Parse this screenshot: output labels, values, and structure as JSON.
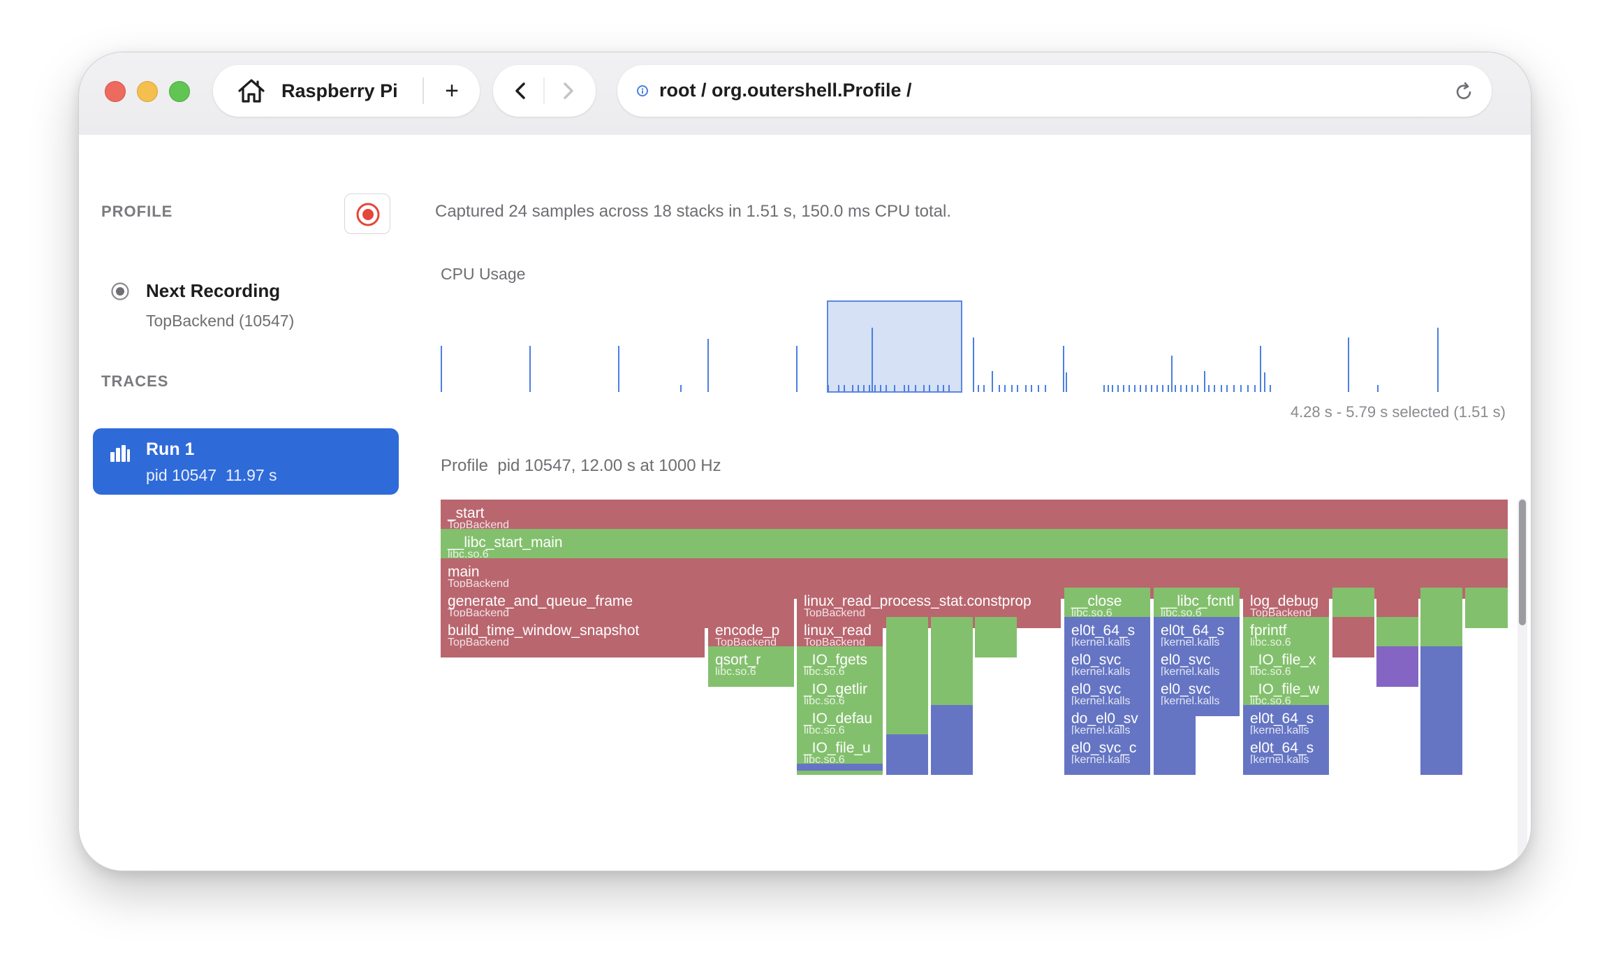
{
  "browser": {
    "tab_title": "Raspberry Pi",
    "new_tab_label": "+",
    "url": "root / org.outershell.Profile /"
  },
  "sidebar": {
    "profile_heading": "PROFILE",
    "next_recording": {
      "title": "Next Recording",
      "subtitle": "TopBackend (10547)"
    },
    "traces_heading": "TRACES",
    "runs": [
      {
        "title": "Run 1",
        "subtitle": "pid 10547  11.97 s"
      }
    ]
  },
  "main": {
    "summary": "Captured 24 samples across 18 stacks in 1.51 s, 150.0 ms CPU total.",
    "cpu_usage_label": "CPU Usage",
    "selection_text": "4.28 s - 5.79 s selected (1.51 s)",
    "profile_label": "Profile  pid 10547, 12.00 s at 1000 Hz"
  },
  "colors": {
    "accent": "#2f6ad9",
    "user_frame": "#b9666f",
    "libc_frame": "#83c06d",
    "kernel_frame": "#6575c3",
    "other_frame": "#8465c3",
    "cpu_line": "#4a7fe0",
    "record": "#e5453a"
  },
  "flamegraph": {
    "rows": [
      [
        {
          "fn": "_start",
          "lib": "TopBackend",
          "color": "red"
        }
      ],
      [
        {
          "fn": "__libc_start_main",
          "lib": "libc.so.6",
          "color": "green"
        }
      ],
      [
        {
          "fn": "main",
          "lib": "TopBackend",
          "color": "red"
        }
      ],
      [
        {
          "fn": "generate_and_queue_frame",
          "lib": "TopBackend",
          "color": "red"
        },
        {
          "fn": "linux_read_process_stat.constprop",
          "lib": "TopBackend",
          "color": "red"
        },
        {
          "fn": "__close",
          "lib": "libc.so.6",
          "color": "green"
        },
        {
          "fn": "__libc_fcntl",
          "lib": "libc.so.6",
          "color": "green"
        },
        {
          "fn": "log_debug",
          "lib": "TopBackend",
          "color": "red"
        },
        {
          "fn": "",
          "lib": "",
          "color": "green"
        },
        {
          "fn": "",
          "lib": "",
          "color": "red"
        },
        {
          "fn": "",
          "lib": "",
          "color": "green"
        },
        {
          "fn": "",
          "lib": "",
          "color": "green"
        }
      ],
      [
        {
          "fn": "build_time_window_snapshot",
          "lib": "TopBackend",
          "color": "red"
        },
        {
          "fn": "encode_p",
          "lib": "TopBackend",
          "color": "red"
        },
        {
          "fn": "linux_read",
          "lib": "TopBackend",
          "color": "red"
        },
        {
          "fn": "",
          "lib": "",
          "color": "green"
        },
        {
          "fn": "",
          "lib": "",
          "color": "green"
        },
        {
          "fn": "",
          "lib": "",
          "color": "green"
        },
        {
          "fn": "el0t_64_s",
          "lib": "[kernel.kalls",
          "color": "blue"
        },
        {
          "fn": "el0t_64_s",
          "lib": "[kernel.kalls",
          "color": "blue"
        },
        {
          "fn": "fprintf",
          "lib": "libc.so.6",
          "color": "green"
        },
        {
          "fn": "",
          "lib": "",
          "color": "red"
        },
        {
          "fn": "",
          "lib": "",
          "color": "green"
        },
        {
          "fn": "",
          "lib": "",
          "color": "green"
        }
      ],
      [
        {
          "fn": "qsort_r",
          "lib": "libc.so.6",
          "color": "green"
        },
        {
          "fn": "_IO_fgets",
          "lib": "libc.so.6",
          "color": "green"
        },
        {
          "fn": "",
          "lib": "",
          "color": "green"
        },
        {
          "fn": "",
          "lib": "",
          "color": "green"
        },
        {
          "fn": "el0_svc",
          "lib": "[kernel.kalls",
          "color": "blue"
        },
        {
          "fn": "el0_svc",
          "lib": "[kernel.kalls",
          "color": "blue"
        },
        {
          "fn": "_IO_file_x",
          "lib": "libc.so.6",
          "color": "green"
        },
        {
          "fn": "",
          "lib": "",
          "color": "purple"
        },
        {
          "fn": "",
          "lib": "",
          "color": "blue"
        }
      ],
      [
        {
          "fn": "_IO_getlir",
          "lib": "libc.so.6",
          "color": "green"
        },
        {
          "fn": "",
          "lib": "",
          "color": "green"
        },
        {
          "fn": "",
          "lib": "",
          "color": "green"
        },
        {
          "fn": "el0_svc",
          "lib": "[kernel.kalls",
          "color": "blue"
        },
        {
          "fn": "el0_svc",
          "lib": "[kernel.kalls",
          "color": "blue"
        },
        {
          "fn": "_IO_file_w",
          "lib": "libc.so.6",
          "color": "green"
        },
        {
          "fn": "",
          "lib": "",
          "color": "blue"
        }
      ],
      [
        {
          "fn": "_IO_defau",
          "lib": "libc.so.6",
          "color": "green"
        },
        {
          "fn": "",
          "lib": "",
          "color": "green"
        },
        {
          "fn": "",
          "lib": "",
          "color": "blue"
        },
        {
          "fn": "do_el0_sv",
          "lib": "[kernel.kalls",
          "color": "blue"
        },
        {
          "fn": "",
          "lib": "",
          "color": "blue"
        },
        {
          "fn": "el0t_64_s",
          "lib": "[kernel.kalls",
          "color": "blue"
        },
        {
          "fn": "",
          "lib": "",
          "color": "blue"
        }
      ],
      [
        {
          "fn": "_IO_file_u",
          "lib": "libc.so.6",
          "color": "green"
        },
        {
          "fn": "",
          "lib": "",
          "color": "blue"
        },
        {
          "fn": "",
          "lib": "",
          "color": "blue"
        },
        {
          "fn": "el0_svc_c",
          "lib": "[kernel.kalls",
          "color": "blue"
        },
        {
          "fn": "",
          "lib": "",
          "color": "blue"
        },
        {
          "fn": "el0t_64_s",
          "lib": "[kernel.kalls",
          "color": "blue"
        },
        {
          "fn": "",
          "lib": "",
          "color": "blue"
        }
      ],
      [
        {
          "fn": "",
          "lib": "",
          "color": "blue"
        },
        {
          "fn": "",
          "lib": "",
          "color": "blue"
        },
        {
          "fn": "",
          "lib": "",
          "color": "blue"
        },
        {
          "fn": "",
          "lib": "",
          "color": "blue"
        },
        {
          "fn": "",
          "lib": "",
          "color": "blue"
        },
        {
          "fn": "",
          "lib": "",
          "color": "blue"
        },
        {
          "fn": "",
          "lib": "",
          "color": "blue"
        }
      ]
    ]
  }
}
